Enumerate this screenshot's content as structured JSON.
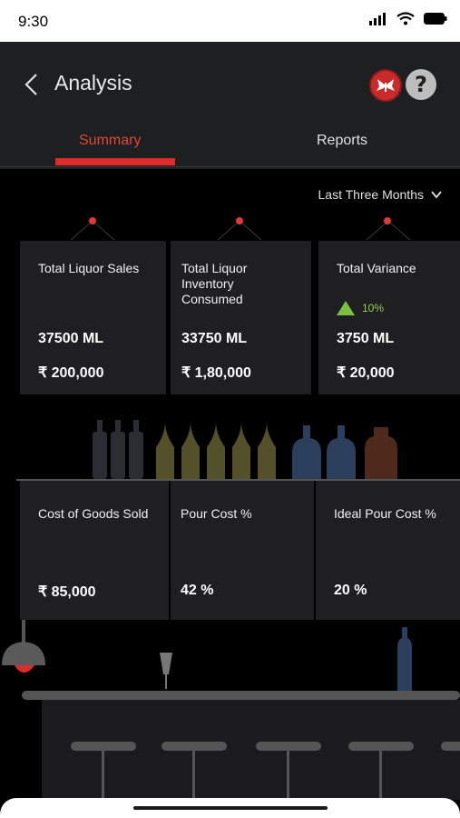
{
  "status": {
    "time": "9:30"
  },
  "header": {
    "title": "Analysis",
    "help_label": "?"
  },
  "tabs": [
    {
      "label": "Summary",
      "active": true
    },
    {
      "label": "Reports",
      "active": false
    }
  ],
  "filter": {
    "period": "Last Three Months"
  },
  "metrics_top": [
    {
      "label": "Total Liquor Sales",
      "volume": "37500 ML",
      "amount": "₹ 200,000"
    },
    {
      "label": "Total Liquor Inventory Consumed",
      "volume": "33750 ML",
      "amount": "₹ 1,80,000"
    },
    {
      "label": "Total Variance",
      "trend": "10%",
      "volume": "3750 ML",
      "amount": "₹ 20,000"
    }
  ],
  "metrics_bottom": [
    {
      "label": "Cost of Goods Sold",
      "value": "₹ 85,000"
    },
    {
      "label": "Pour Cost %",
      "value": "42 %"
    },
    {
      "label": "Ideal Pour Cost %",
      "value": "20 %"
    }
  ],
  "colors": {
    "accent": "#e02b2b",
    "header_bg": "#1e1f21",
    "card_bg": "#1f1f21",
    "trend_up": "#8fd14f"
  },
  "icons": {
    "back": "chevron-left-icon",
    "brand": "brand-logo-icon",
    "help": "help-icon",
    "period": "chevron-down-icon",
    "trend": "triangle-up-icon"
  }
}
